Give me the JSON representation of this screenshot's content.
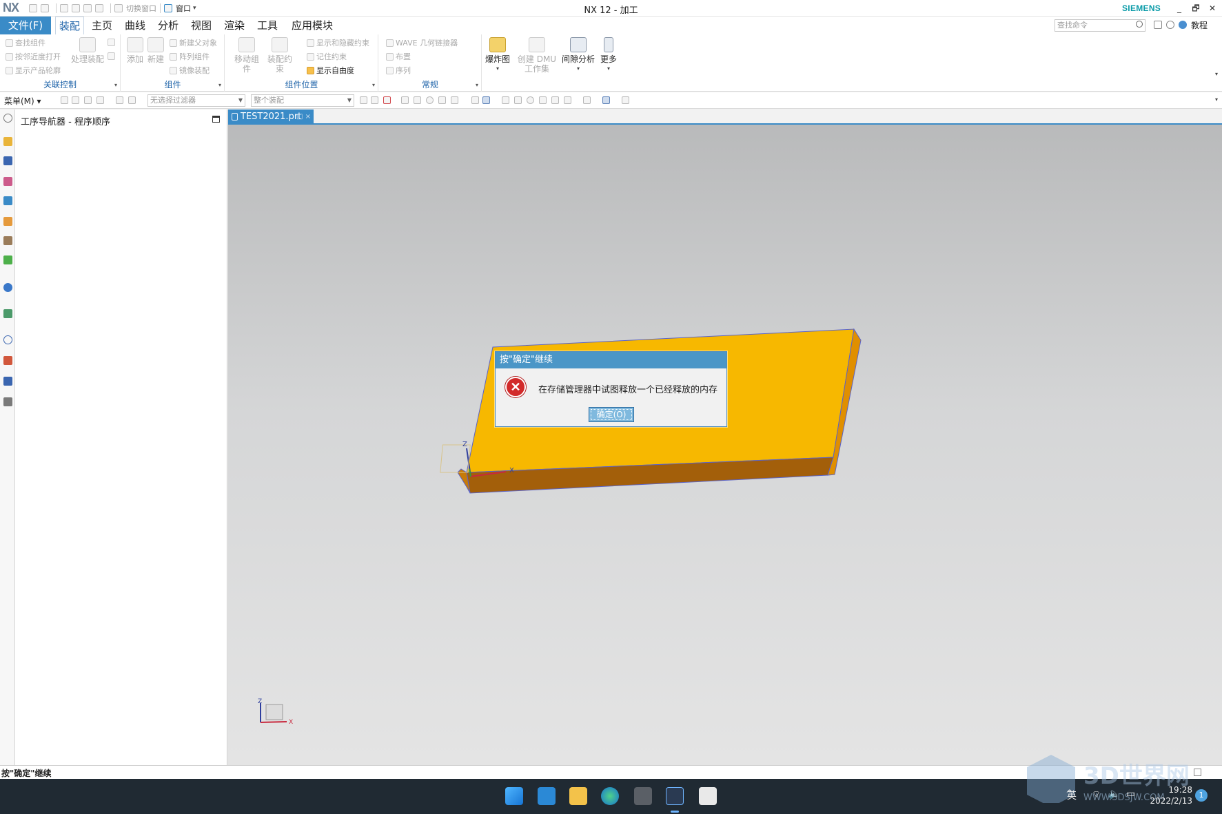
{
  "window": {
    "app_logo": "NX",
    "title": "NX 12 - 加工",
    "brand": "SIEMENS",
    "controls": [
      "_",
      "🗗",
      "✕"
    ],
    "qa_switch_window": "切换窗口",
    "qa_window": "窗口"
  },
  "menubar": {
    "file": "文件(F)",
    "tabs": [
      "装配",
      "主页",
      "曲线",
      "分析",
      "视图",
      "渲染",
      "工具",
      "应用模块"
    ],
    "active_tab": "装配",
    "search_placeholder": "查找命令",
    "tutorial": "教程"
  },
  "ribbon": {
    "group1": {
      "label": "关联控制",
      "items": [
        "查找组件",
        "按邻近度打开",
        "显示产品轮廓"
      ],
      "big": "处理装配"
    },
    "group2": {
      "label": "组件",
      "big": [
        "添加",
        "新建"
      ],
      "items": [
        "新建父对象",
        "阵列组件",
        "镜像装配"
      ]
    },
    "group3": {
      "label": "组件位置",
      "big": [
        "移动组件",
        "装配约束"
      ],
      "items": [
        "显示和隐藏约束",
        "记住约束",
        "显示自由度"
      ]
    },
    "group4": {
      "label": "常规",
      "items": [
        "WAVE 几何链接器",
        "布置",
        "序列"
      ]
    },
    "big_tools": [
      "爆炸图",
      "创建 DMU 工作集",
      "间隙分析",
      "更多"
    ]
  },
  "toolbar": {
    "menu": "菜单(M)",
    "filter_placeholder": "无选择过滤器",
    "scope_placeholder": "整个装配"
  },
  "navigator": {
    "title": "工序导航器 - 程序顺序"
  },
  "document": {
    "tab": "TEST2021.prt",
    "triad_labels": [
      "Z",
      "Y",
      "X"
    ]
  },
  "dialog": {
    "title": "按\"确定\"继续",
    "message": "在存储管理器中试图释放一个已经释放的内存",
    "ok": "确定(O)"
  },
  "status": {
    "text": "按\"确定\"继续"
  },
  "taskbar": {
    "ime": "英",
    "time": "19:28",
    "date": "2022/2/13",
    "notify_count": "1",
    "watermark": "3D世界网",
    "watermark_url": "WWW.3DSJW.COM"
  },
  "colors": {
    "accent": "#3a8bc7",
    "part_top": "#f7b800",
    "part_side": "#a8610a",
    "error": "#d22a2a"
  }
}
